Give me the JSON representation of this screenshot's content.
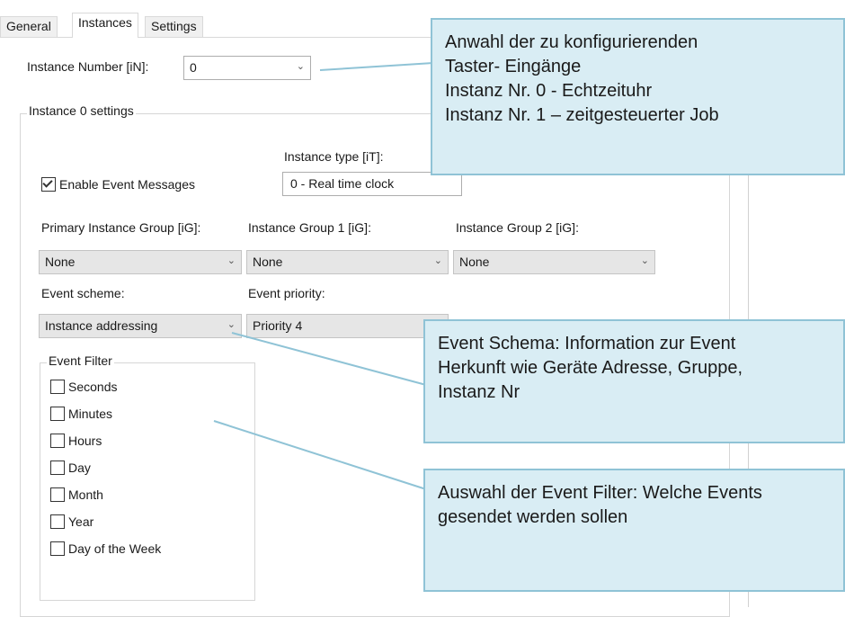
{
  "tabs": [
    {
      "label": "General"
    },
    {
      "label": "Instances"
    },
    {
      "label": "Settings"
    }
  ],
  "instance_number": {
    "label": "Instance Number [iN]:",
    "value": "0"
  },
  "instance_settings": {
    "group_title": "Instance 0 settings",
    "instance_type": {
      "label": "Instance type [iT]:",
      "value": "0 - Real time clock"
    },
    "enable_event_messages": {
      "label": "Enable Event Messages",
      "checked": true
    },
    "primary_group": {
      "label": "Primary Instance Group [iG]:",
      "value": "None"
    },
    "group1": {
      "label": "Instance Group 1 [iG]:",
      "value": "None"
    },
    "group2": {
      "label": "Instance Group 2 [iG]:",
      "value": "None"
    },
    "event_scheme": {
      "label": "Event scheme:",
      "value": "Instance addressing"
    },
    "event_priority": {
      "label": "Event priority:",
      "value": "Priority 4"
    },
    "event_filter": {
      "title": "Event Filter",
      "items": [
        {
          "label": "Seconds",
          "checked": false
        },
        {
          "label": "Minutes",
          "checked": false
        },
        {
          "label": "Hours",
          "checked": false
        },
        {
          "label": "Day",
          "checked": false
        },
        {
          "label": "Month",
          "checked": false
        },
        {
          "label": "Year",
          "checked": false
        },
        {
          "label": "Day of the Week",
          "checked": false
        }
      ]
    }
  },
  "callouts": [
    {
      "lines": [
        "Anwahl der zu konfigurierenden",
        "Taster- Eingänge",
        "Instanz Nr. 0 - Echtzeituhr",
        "Instanz Nr. 1 – zeitgesteuerter Job"
      ]
    },
    {
      "lines": [
        "Event Schema: Information zur Event",
        "Herkunft wie Geräte Adresse, Gruppe,",
        "Instanz Nr"
      ]
    },
    {
      "lines": [
        "Auswahl der Event Filter: Welche Events",
        "gesendet werden sollen"
      ]
    }
  ],
  "colors": {
    "callout_bg": "#d9edf4",
    "callout_border": "#8fc3d6",
    "connector": "#8fc3d6"
  },
  "icons": {
    "dropdown": "chevron-down-icon",
    "checkbox": "checkbox-icon"
  }
}
